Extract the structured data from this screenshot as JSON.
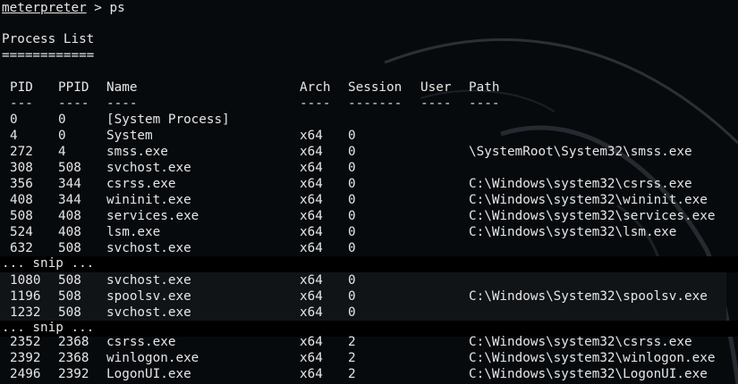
{
  "prompt": {
    "name": "meterpreter",
    "rest": " > ps"
  },
  "title": "Process List",
  "underline": "============",
  "columns": [
    {
      "key": "pid",
      "label": "PID",
      "dash": "---"
    },
    {
      "key": "ppid",
      "label": "PPID",
      "dash": "----"
    },
    {
      "key": "name",
      "label": "Name",
      "dash": "----"
    },
    {
      "key": "arch",
      "label": "Arch",
      "dash": "----"
    },
    {
      "key": "session",
      "label": "Session",
      "dash": "-------"
    },
    {
      "key": "user",
      "label": "User",
      "dash": "----"
    },
    {
      "key": "path",
      "label": "Path",
      "dash": "----"
    }
  ],
  "rows_a": [
    {
      "pid": "0",
      "ppid": "0",
      "name": "[System Process]",
      "arch": "",
      "session": "",
      "user": "",
      "path": ""
    },
    {
      "pid": "4",
      "ppid": "0",
      "name": "System",
      "arch": "x64",
      "session": "0",
      "user": "",
      "path": ""
    },
    {
      "pid": "272",
      "ppid": "4",
      "name": "smss.exe",
      "arch": "x64",
      "session": "0",
      "user": "",
      "path": "\\SystemRoot\\System32\\smss.exe"
    },
    {
      "pid": "308",
      "ppid": "508",
      "name": "svchost.exe",
      "arch": "x64",
      "session": "0",
      "user": "",
      "path": ""
    },
    {
      "pid": "356",
      "ppid": "344",
      "name": "csrss.exe",
      "arch": "x64",
      "session": "0",
      "user": "",
      "path": "C:\\Windows\\system32\\csrss.exe"
    },
    {
      "pid": "408",
      "ppid": "344",
      "name": "wininit.exe",
      "arch": "x64",
      "session": "0",
      "user": "",
      "path": "C:\\Windows\\system32\\wininit.exe"
    },
    {
      "pid": "508",
      "ppid": "408",
      "name": "services.exe",
      "arch": "x64",
      "session": "0",
      "user": "",
      "path": "C:\\Windows\\system32\\services.exe"
    },
    {
      "pid": "524",
      "ppid": "408",
      "name": "lsm.exe",
      "arch": "x64",
      "session": "0",
      "user": "",
      "path": "C:\\Windows\\system32\\lsm.exe"
    },
    {
      "pid": "632",
      "ppid": "508",
      "name": "svchost.exe",
      "arch": "x64",
      "session": "0",
      "user": "",
      "path": ""
    }
  ],
  "snip1": "... snip ...",
  "rows_b": [
    {
      "pid": "1080",
      "ppid": "508",
      "name": "svchost.exe",
      "arch": "x64",
      "session": "0",
      "user": "",
      "path": ""
    },
    {
      "pid": "1196",
      "ppid": "508",
      "name": "spoolsv.exe",
      "arch": "x64",
      "session": "0",
      "user": "",
      "path": "C:\\Windows\\System32\\spoolsv.exe"
    },
    {
      "pid": "1232",
      "ppid": "508",
      "name": "svchost.exe",
      "arch": "x64",
      "session": "0",
      "user": "",
      "path": ""
    }
  ],
  "snip2": "... snip ...",
  "rows_c": [
    {
      "pid": "2352",
      "ppid": "2368",
      "name": "csrss.exe",
      "arch": "x64",
      "session": "2",
      "user": "",
      "path": "C:\\Windows\\system32\\csrss.exe"
    },
    {
      "pid": "2392",
      "ppid": "2368",
      "name": "winlogon.exe",
      "arch": "x64",
      "session": "2",
      "user": "",
      "path": "C:\\Windows\\system32\\winlogon.exe"
    },
    {
      "pid": "2496",
      "ppid": "2392",
      "name": "LogonUI.exe",
      "arch": "x64",
      "session": "2",
      "user": "",
      "path": "C:\\Windows\\system32\\LogonUI.exe"
    }
  ],
  "colors": {
    "background": "#070a0d",
    "text": "#e6e6e6",
    "wallpaper_curve": "#2b3036"
  }
}
